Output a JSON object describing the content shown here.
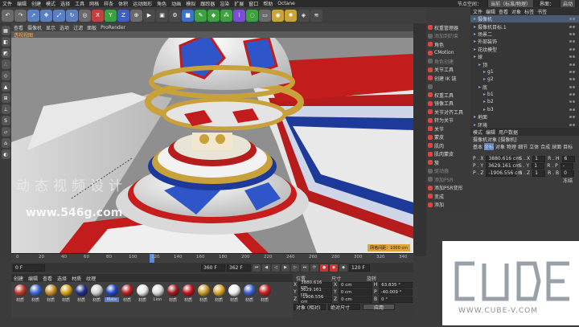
{
  "menu": [
    "文件",
    "编辑",
    "创建",
    "模式",
    "选择",
    "工具",
    "网格",
    "样条",
    "体积",
    "运动图形",
    "角色",
    "动画",
    "模拟",
    "跟踪器",
    "渲染",
    "扩展",
    "窗口",
    "帮助",
    "Octane"
  ],
  "menu_right": {
    "node_label": "节点空间：",
    "node_value": "当前（标准/物理）",
    "layout_label": "界面：",
    "layout_value": "启动"
  },
  "viewport": {
    "menu": [
      "查看",
      "摄像机",
      "显示",
      "选项",
      "过滤",
      "面板",
      "ProRender"
    ],
    "label": "透视视图",
    "hud": "网格间距：1000 cm"
  },
  "mid_panel": [
    {
      "label": "权重管理器",
      "dim": false
    },
    {
      "label": "添加到约束",
      "dim": true
    },
    {
      "label": "角色",
      "dim": false
    },
    {
      "label": "CMotion",
      "dim": false
    },
    {
      "label": "角色创建",
      "dim": true
    },
    {
      "label": "关节工具",
      "dim": false
    },
    {
      "label": "创建 IK 链",
      "dim": false
    },
    {
      "label": "",
      "dim": true
    },
    {
      "label": "权重工具",
      "dim": false
    },
    {
      "label": "镜像工具",
      "dim": false
    },
    {
      "label": "关节对齐工具",
      "dim": false
    },
    {
      "label": "转为关节",
      "dim": false
    },
    {
      "label": "关节",
      "dim": false
    },
    {
      "label": "蒙皮",
      "dim": false
    },
    {
      "label": "肌肉",
      "dim": false
    },
    {
      "label": "肌肉蒙皮",
      "dim": false
    },
    {
      "label": "簇",
      "dim": false
    },
    {
      "label": "驱动器",
      "dim": true
    },
    {
      "label": "添加PSR",
      "dim": true
    },
    {
      "label": "添加PSR变形",
      "dim": false
    },
    {
      "label": "变成",
      "dim": false
    },
    {
      "label": "添加",
      "dim": false
    }
  ],
  "object_manager": {
    "tabs": [
      "文件",
      "编辑",
      "查看",
      "对象",
      "标签",
      "书签"
    ],
    "rows": [
      {
        "label": "摄像机",
        "sel": true
      },
      {
        "label": "摄像机目标.1",
        "sel": false
      },
      {
        "label": "场景二",
        "sel": false
      },
      {
        "label": "外部装饰",
        "sel": false
      },
      {
        "label": "花纹模型",
        "sel": false
      },
      {
        "label": "球",
        "sel": false
      },
      {
        "label": "顶",
        "sel": false
      },
      {
        "label": "g1",
        "sel": false
      },
      {
        "label": "g2",
        "sel": false
      },
      {
        "label": "底",
        "sel": false
      },
      {
        "label": "b1",
        "sel": false
      },
      {
        "label": "b2",
        "sel": false
      },
      {
        "label": "b3",
        "sel": false
      },
      {
        "label": "地面",
        "sel": false
      },
      {
        "label": "环境",
        "sel": false
      }
    ]
  },
  "attributes": {
    "tabs": [
      "模式",
      "编辑",
      "用户数据"
    ],
    "title": "摄像机对象 [摄像机]",
    "subtabs": [
      "基本",
      "坐标",
      "对象",
      "物理",
      "细节",
      "立体",
      "合成",
      "球面",
      "目标"
    ],
    "rows": [
      {
        "p": "P . X",
        "pv": "3880.616 cm",
        "s": "S . X",
        "sv": "1",
        "r": "R . H",
        "rv": "6"
      },
      {
        "p": "P . Y",
        "pv": "3629.161 cm",
        "s": "S . Y",
        "sv": "1",
        "r": "R . P",
        "rv": "-"
      },
      {
        "p": "P . Z",
        "pv": "-1906.556 cm",
        "s": "S . Z",
        "sv": "1",
        "r": "R . B",
        "rv": "0"
      }
    ],
    "freeze_label": "冻结"
  },
  "timeline": {
    "ticks": [
      "0",
      "20",
      "40",
      "60",
      "80",
      "100",
      "120",
      "140",
      "160",
      "180",
      "200",
      "220",
      "240",
      "260",
      "280",
      "300",
      "320",
      "340"
    ],
    "current": "0 F"
  },
  "transport": {
    "start": "0 F",
    "end": "360 F",
    "end2": "362 F",
    "frame": "120 F"
  },
  "materials": {
    "menu": [
      "创建",
      "编辑",
      "查看",
      "选择",
      "材质",
      "纹理"
    ],
    "items": [
      {
        "label": "材质",
        "color": "#c0392b"
      },
      {
        "label": "材质",
        "color": "#3867d6"
      },
      {
        "label": "材质",
        "color": "#c48a22"
      },
      {
        "label": "材质",
        "color": "#d4a017"
      },
      {
        "label": "材质",
        "color": "#1f2e8c"
      },
      {
        "label": "材质",
        "color": "#cfcfcf"
      },
      {
        "label": "Mate",
        "color": "#2146c4",
        "sel": true
      },
      {
        "label": "材质",
        "color": "#b71c1c"
      },
      {
        "label": "材质",
        "color": "#e8e8e8"
      },
      {
        "label": "Lion",
        "color": "#dadada"
      },
      {
        "label": "材质",
        "color": "#9b1b1b"
      },
      {
        "label": "材质",
        "color": "#c4141a"
      },
      {
        "label": "材质",
        "color": "#c89a2a"
      },
      {
        "label": "材质",
        "color": "#d8a52a"
      },
      {
        "label": "材质",
        "color": "#f0f0f0"
      },
      {
        "label": "材质",
        "color": "#3a5fcd"
      },
      {
        "label": "材质",
        "color": "#c51f1f"
      }
    ]
  },
  "coordinates": {
    "headers": [
      "位置",
      "尺寸",
      "旋转"
    ],
    "rows": [
      {
        "axis": "X",
        "pos": "3880.616 cm",
        "size": "0 cm",
        "rl": "H",
        "rot": "63.835 °"
      },
      {
        "axis": "Y",
        "pos": "3629.161 cm",
        "size": "0 cm",
        "rl": "P",
        "rot": "-40.009 °"
      },
      {
        "axis": "Z",
        "pos": "-1906.556 cm",
        "size": "0 cm",
        "rl": "B",
        "rot": "0 °"
      }
    ],
    "mode": "对象 (相对)",
    "size_mode": "绝对尺寸",
    "apply": "应用"
  },
  "watermark": {
    "cn": "动态视频设计",
    "url": "www.546g.com",
    "brand": "CUBE",
    "brand_url": "WWW.CUBE-V.COM"
  }
}
